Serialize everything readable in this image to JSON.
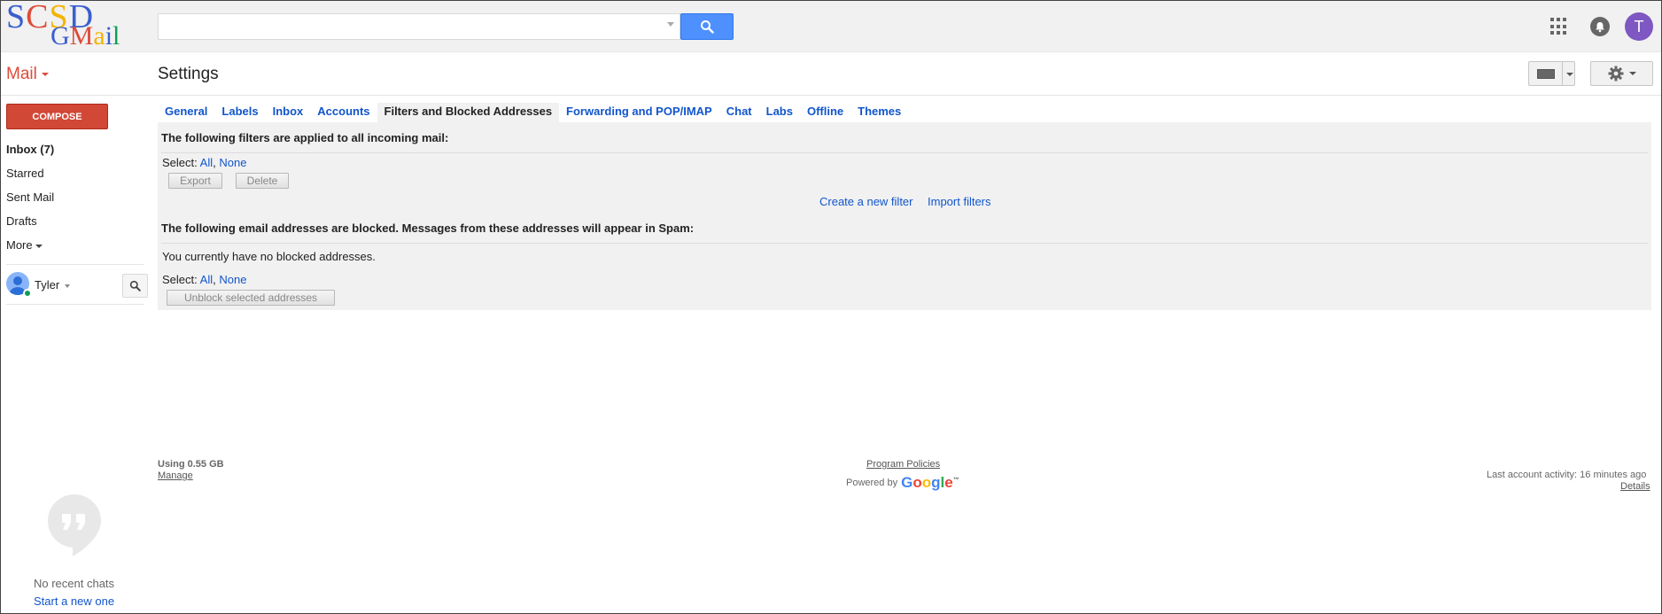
{
  "header": {
    "logo_line1": "SCSD",
    "logo_line2": "GMail",
    "search_placeholder": "",
    "avatar_letter": "T"
  },
  "subheader": {
    "mail_label": "Mail",
    "title": "Settings"
  },
  "sidebar": {
    "compose_label": "COMPOSE",
    "items": [
      {
        "label": "Inbox (7)"
      },
      {
        "label": "Starred"
      },
      {
        "label": "Sent Mail"
      },
      {
        "label": "Drafts"
      },
      {
        "label": "More"
      }
    ],
    "chat_user": "Tyler",
    "no_chats": "No recent chats",
    "start_new": "Start a new one"
  },
  "tabs": [
    {
      "label": "General"
    },
    {
      "label": "Labels"
    },
    {
      "label": "Inbox"
    },
    {
      "label": "Accounts"
    },
    {
      "label": "Filters and Blocked Addresses",
      "active": true
    },
    {
      "label": "Forwarding and POP/IMAP"
    },
    {
      "label": "Chat"
    },
    {
      "label": "Labs"
    },
    {
      "label": "Offline"
    },
    {
      "label": "Themes"
    }
  ],
  "filters": {
    "heading": "The following filters are applied to all incoming mail:",
    "select_label": "Select:",
    "select_all": "All",
    "select_none": "None",
    "export_label": "Export",
    "delete_label": "Delete",
    "create_filter": "Create a new filter",
    "import_filters": "Import filters"
  },
  "blocked": {
    "heading": "The following email addresses are blocked. Messages from these addresses will appear in Spam:",
    "empty_text": "You currently have no blocked addresses.",
    "select_label": "Select:",
    "select_all": "All",
    "select_none": "None",
    "unblock_label": "Unblock selected addresses"
  },
  "footer": {
    "usage": "Using 0.55 GB",
    "manage": "Manage",
    "program_policies": "Program Policies",
    "powered_by": "Powered by",
    "google": "Google",
    "last_activity": "Last account activity: 16 minutes ago",
    "details": "Details"
  },
  "colors": {
    "accent_red": "#dd4b39",
    "compose_red": "#d14836",
    "link_blue": "#1155cc",
    "search_blue": "#4d90fe",
    "avatar_purple": "#7e57c2"
  }
}
